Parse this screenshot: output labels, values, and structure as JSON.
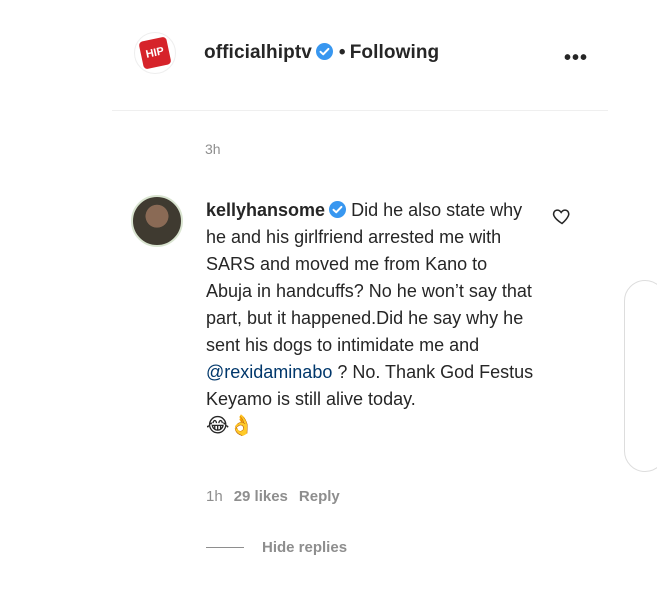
{
  "post_header": {
    "username": "officialhiptv",
    "separator": "•",
    "follow_status": "Following",
    "more_label": "•••",
    "avatar_logo": "HIP"
  },
  "timestamp_top": "3h",
  "comment": {
    "username": "kellyhansome",
    "text_before_mention": "Did he also state why he and his girlfriend arrested me with SARS and moved me from Kano to Abuja in handcuffs? No he won’t say that part, but it happened.Did he say why he sent his dogs to intimidate me and",
    "mention": "@rexidaminabo",
    "text_after_mention": "? No. Thank God Festus Keyamo is still alive today.",
    "emojis": "😂👌",
    "time": "1h",
    "likes": "29 likes",
    "reply_label": "Reply",
    "hide_replies_label": "Hide replies"
  },
  "icons": {
    "verified": "verified-badge-icon",
    "heart": "heart-outline-icon",
    "more": "more-options-icon"
  },
  "colors": {
    "verified": "#3897f0",
    "text": "#262626",
    "secondary": "#8e8e8e",
    "mention": "#00376b",
    "logo": "#d6232a"
  }
}
